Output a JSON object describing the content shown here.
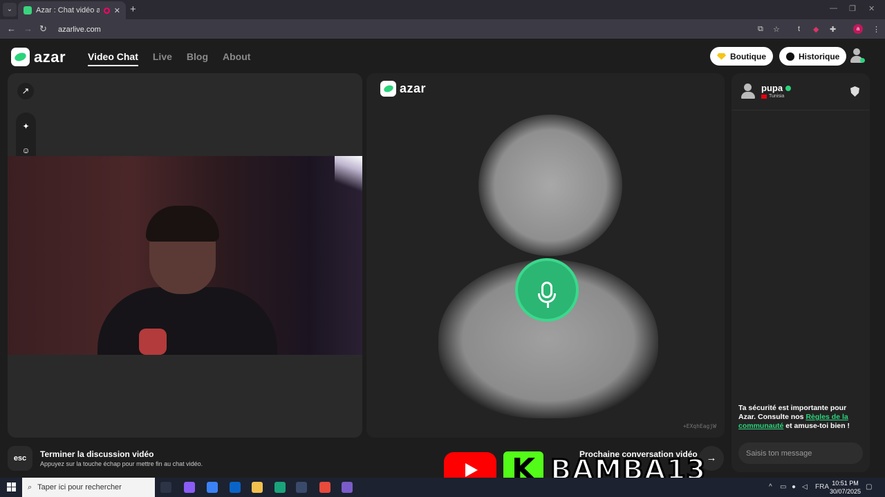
{
  "browser": {
    "tab_title": "Azar : Chat vidéo avec de n",
    "tab_close": "✕",
    "new_tab": "+",
    "url": "azarlive.com",
    "profile_initial": "a",
    "window_controls": [
      "—",
      "❐",
      "✕"
    ]
  },
  "header": {
    "logo_text": "azar",
    "nav": [
      {
        "label": "Video Chat",
        "active": true
      },
      {
        "label": "Live",
        "active": false
      },
      {
        "label": "Blog",
        "active": false
      },
      {
        "label": "About",
        "active": false
      }
    ],
    "shop_label": "Boutique",
    "history_label": "Historique"
  },
  "left_panel": {
    "expand_icon": "↗",
    "sparkle_icon": "✦",
    "face_icon": "☺"
  },
  "center_panel": {
    "logo_text": "azar",
    "watermark_id": "+EXqhEagjW"
  },
  "chat": {
    "partner_name": "pupa",
    "partner_country": "Tunisia",
    "safety_prefix": "Ta sécurité est importante pour Azar. Consulte nos ",
    "safety_link": "Règles de la communauté",
    "safety_suffix": " et amuse-toi bien !",
    "input_placeholder": "Saisis ton message"
  },
  "bottom_bar": {
    "esc_key": "esc",
    "end_title": "Terminer la discussion vidéo",
    "end_subtitle": "Appuyez sur la touche échap pour mettre fin au chat vidéo.",
    "next_label": "Prochaine conversation vidéo",
    "next_arrow": "→"
  },
  "overlay": {
    "kick_letter": "K",
    "handle": "BAMBA13"
  },
  "taskbar": {
    "search_placeholder": "Taper ici pour rechercher",
    "language": "FRA",
    "time": "10:51 PM",
    "date": "30/07/2025"
  },
  "colors": {
    "brand_green": "#2ad47b",
    "youtube_red": "#ff0000",
    "kick_green": "#53fc18"
  }
}
